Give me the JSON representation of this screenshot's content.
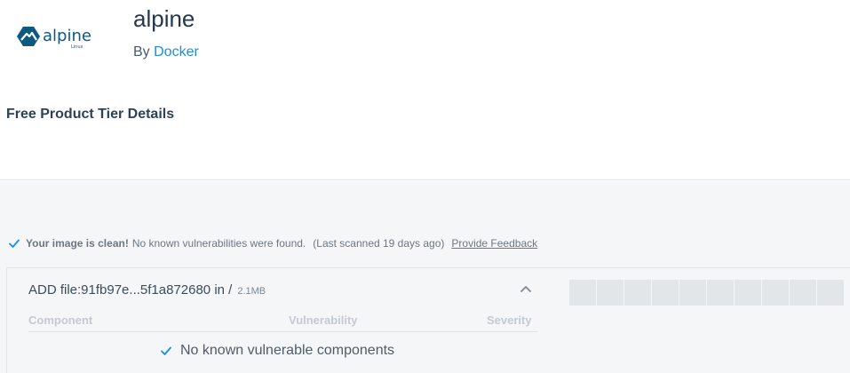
{
  "header": {
    "logo_text": "alpine",
    "logo_subtext": "Linux",
    "title": "alpine",
    "by_prefix": "By",
    "publisher": "Docker"
  },
  "tier": {
    "label": "Free Product Tier Details"
  },
  "scan": {
    "clean_label": "Your image is clean!",
    "message": "No known vulnerabilities were found.",
    "last_scanned": "(Last scanned 19 days ago)",
    "feedback_link": "Provide Feedback"
  },
  "layer": {
    "command": "ADD file:91fb97e...5f1a872680 in /",
    "size": "2.1MB",
    "columns": {
      "component": "Component",
      "vulnerability": "Vulnerability",
      "severity": "Severity"
    },
    "empty_message": "No known vulnerable components",
    "severity_block_count": 10
  },
  "colors": {
    "accent_link": "#1d8ed8",
    "check_blue": "#1d8ed8",
    "logo_blue": "#0d597f"
  },
  "icons": [
    "alpine-logo",
    "check-icon",
    "chevron-up-icon"
  ]
}
